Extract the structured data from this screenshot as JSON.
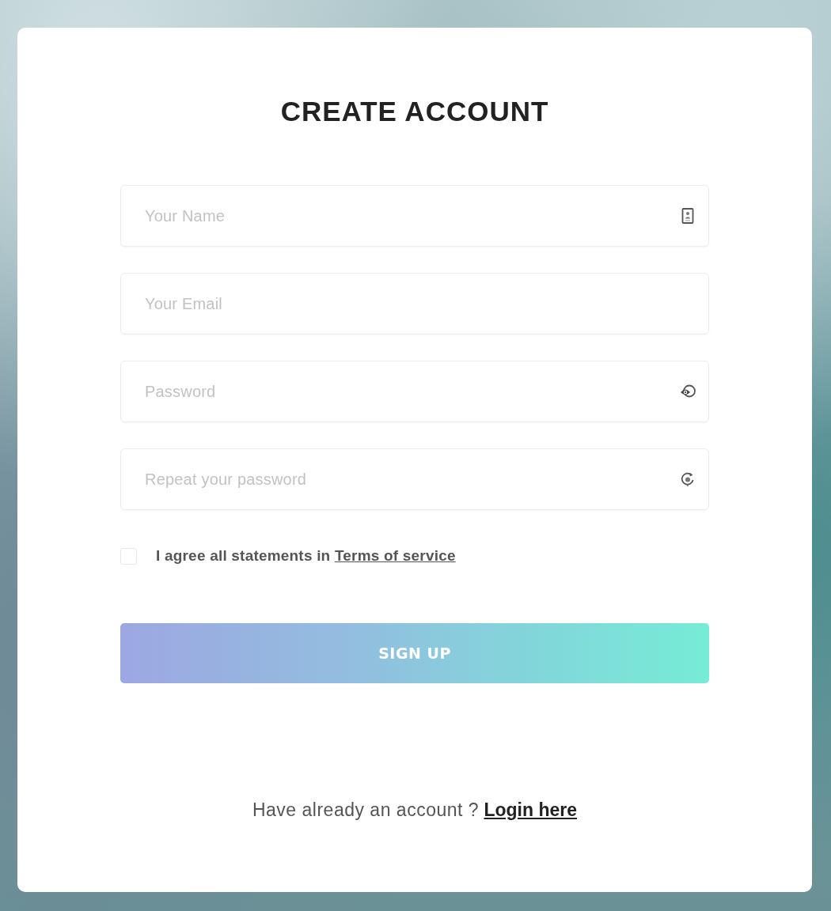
{
  "title": "CREATE ACCOUNT",
  "fields": [
    {
      "kind": "text",
      "placeholder": "Your Name"
    },
    {
      "kind": "email",
      "placeholder": "Your Email"
    },
    {
      "kind": "password",
      "placeholder": "Password"
    },
    {
      "kind": "confirm",
      "placeholder": "Repeat your password"
    }
  ],
  "agreement": {
    "checked": false,
    "label": "I agree all statements in",
    "link": "Terms of service"
  },
  "submit": {
    "label": "SIGN UP"
  },
  "footer": {
    "text": "Have already an account ?",
    "link": "Login here"
  }
}
